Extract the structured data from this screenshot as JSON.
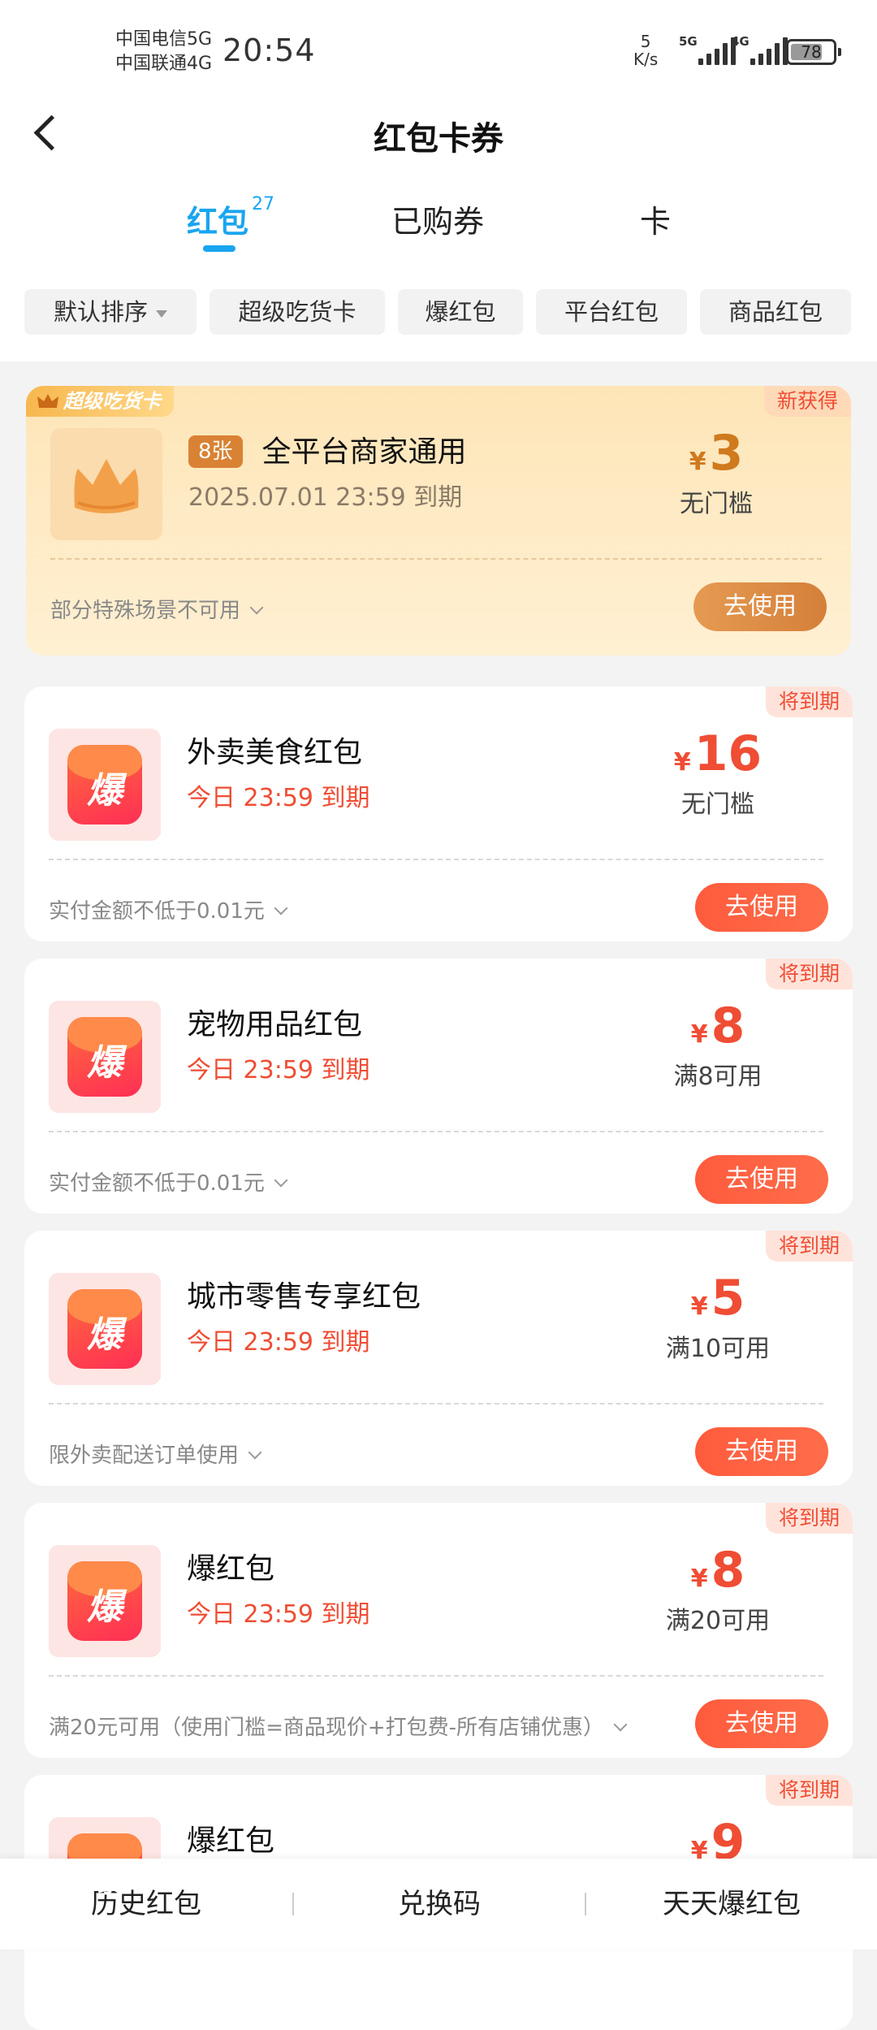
{
  "status_bar": {
    "carrier1": "中国电信5G",
    "carrier2": "中国联通4G",
    "time": "20:54",
    "speed_value": "5",
    "speed_unit": "K/s",
    "signal1": "5G",
    "signal2": "4G",
    "battery": "78",
    "battery_level": 0.78
  },
  "header": {
    "title": "红包卡券"
  },
  "tabs": [
    {
      "label": "红包",
      "count": "27",
      "active": true
    },
    {
      "label": "已购券"
    },
    {
      "label": "卡"
    }
  ],
  "filters": [
    "默认排序",
    "超级吃货卡",
    "爆红包",
    "平台红包",
    "商品红包"
  ],
  "icon_char": "爆",
  "use_label": "去使用",
  "cards": [
    {
      "brand": "超级吃货卡",
      "badge": "新获得",
      "count": "8张",
      "name": "全平台商家通用",
      "expire": "2025.07.01 23:59 到期",
      "currency": "¥",
      "amount": "3",
      "condition": "无门槛",
      "rule": "部分特殊场景不可用"
    },
    {
      "badge": "将到期",
      "name": "外卖美食红包",
      "expire": "今日 23:59 到期",
      "currency": "¥",
      "amount": "16",
      "condition": "无门槛",
      "rule": "实付金额不低于0.01元"
    },
    {
      "badge": "将到期",
      "name": "宠物用品红包",
      "expire": "今日 23:59 到期",
      "currency": "¥",
      "amount": "8",
      "condition": "满8可用",
      "rule": "实付金额不低于0.01元"
    },
    {
      "badge": "将到期",
      "name": "城市零售专享红包",
      "expire": "今日 23:59 到期",
      "currency": "¥",
      "amount": "5",
      "condition": "满10可用",
      "rule": "限外卖配送订单使用"
    },
    {
      "badge": "将到期",
      "name": "爆红包",
      "expire": "今日 23:59 到期",
      "currency": "¥",
      "amount": "8",
      "condition": "满20可用",
      "rule": "满20元可用（使用门槛=商品现价+打包费-所有店铺优惠）"
    },
    {
      "badge": "将到期",
      "name": "爆红包",
      "currency": "¥",
      "amount": "9"
    }
  ],
  "bottom_bar": [
    "历史红包",
    "兑换码",
    "天天爆红包"
  ],
  "colors": {
    "accent_blue": "#1aa5f0",
    "red": "#ef4d34",
    "gold": "#d07a1e"
  }
}
